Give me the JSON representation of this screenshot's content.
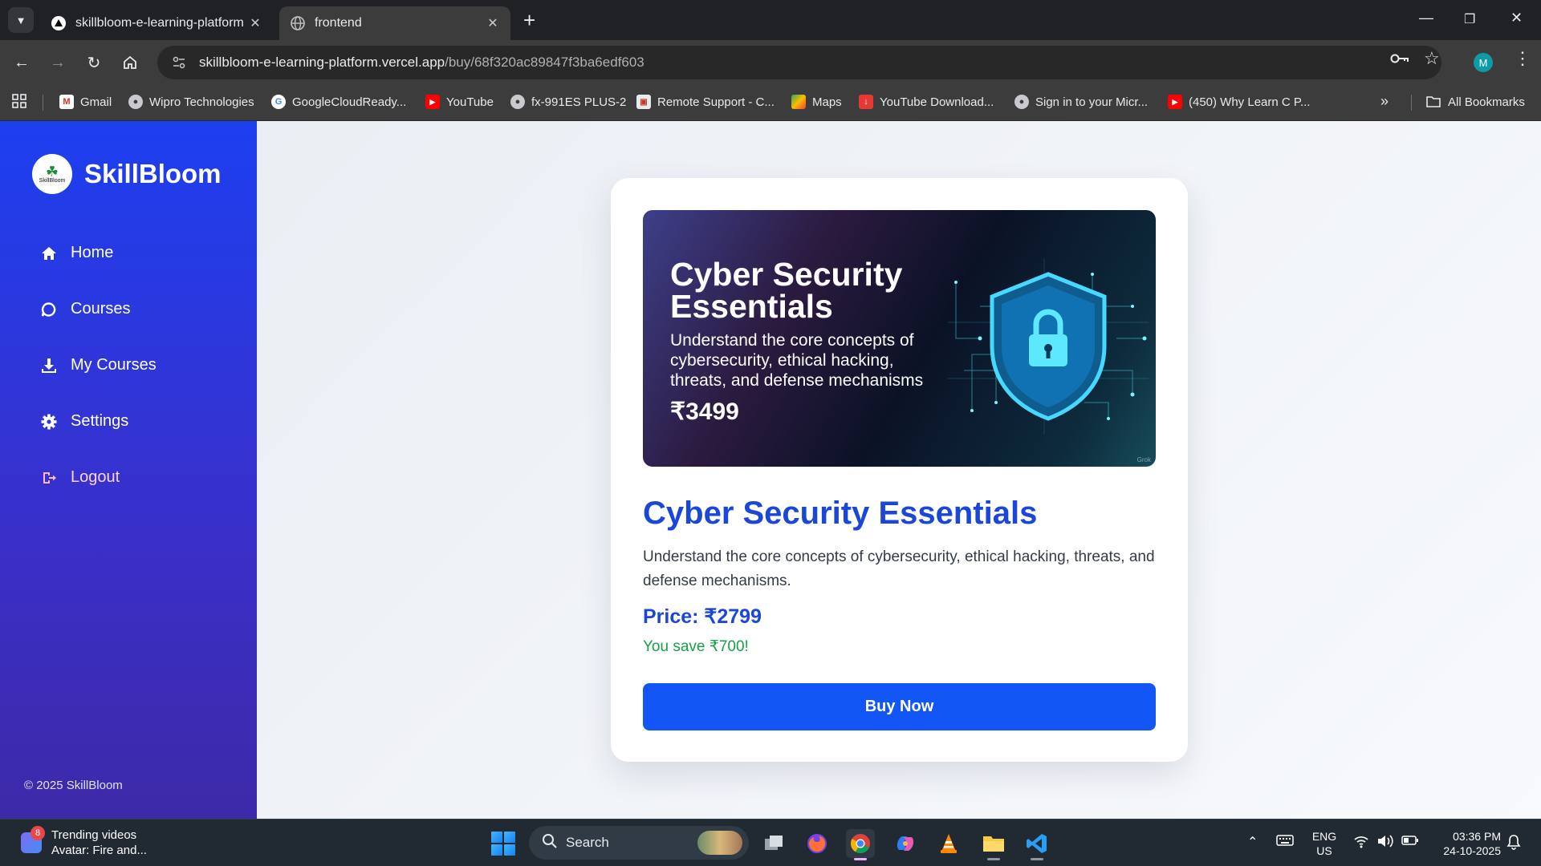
{
  "browser": {
    "tabs": [
      {
        "title": "skillbloom-e-learning-platform",
        "favicon": "vercel-triangle-icon",
        "active": false
      },
      {
        "title": "frontend",
        "favicon": "globe-icon",
        "active": true
      }
    ],
    "url": {
      "host": "skillbloom-e-learning-platform.vercel.app",
      "path": "/buy/68f320ac89847f3ba6edf603"
    },
    "profile_initial": "M",
    "bookmarks": [
      {
        "label": "Gmail",
        "icon": "gmail-icon"
      },
      {
        "label": "Wipro Technologies",
        "icon": "globe-icon"
      },
      {
        "label": "GoogleCloudReady...",
        "icon": "google-icon"
      },
      {
        "label": "YouTube",
        "icon": "youtube-icon"
      },
      {
        "label": "fx-991ES PLUS-2",
        "icon": "globe-icon"
      },
      {
        "label": "Remote Support - C...",
        "icon": "remote-support-icon"
      },
      {
        "label": "Maps",
        "icon": "maps-icon"
      },
      {
        "label": "YouTube Download...",
        "icon": "download-icon"
      },
      {
        "label": "Sign in to your Micr...",
        "icon": "globe-icon"
      },
      {
        "label": "(450) Why Learn C P...",
        "icon": "youtube-icon"
      }
    ],
    "all_bookmarks": "All Bookmarks"
  },
  "sidebar": {
    "brand": "SkillBloom",
    "logo_text": "SkillBloom",
    "items": [
      {
        "label": "Home",
        "icon": "home-icon"
      },
      {
        "label": "Courses",
        "icon": "chat-bubble-icon"
      },
      {
        "label": "My Courses",
        "icon": "download-icon"
      },
      {
        "label": "Settings",
        "icon": "gear-icon"
      },
      {
        "label": "Logout",
        "icon": "logout-icon"
      }
    ],
    "copyright": "© 2025 SkillBloom"
  },
  "course": {
    "banner": {
      "title": "Cyber Security Essentials",
      "description": "Understand the core concepts of cybersecurity, ethical hacking, threats, and defense mechanisms",
      "price": "₹3499",
      "watermark": "Grok"
    },
    "title": "Cyber Security Essentials",
    "description": "Understand the core concepts of cybersecurity, ethical hacking, threats, and defense mechanisms.",
    "price_label": "Price: ₹2799",
    "savings": "You save ₹700!",
    "buy_label": "Buy Now"
  },
  "taskbar": {
    "widget_title": "Trending videos",
    "widget_subtitle": "Avatar: Fire and...",
    "widget_badge": "8",
    "search_placeholder": "Search",
    "language": "ENG",
    "region": "US",
    "time": "03:36 PM",
    "date": "24-10-2025"
  },
  "colors": {
    "sidebar_top": "#1d3ff0",
    "sidebar_bottom": "#3d2aa8",
    "accent_blue": "#1b47d9",
    "button_blue": "#1257f5",
    "savings_green": "#17a04a"
  }
}
